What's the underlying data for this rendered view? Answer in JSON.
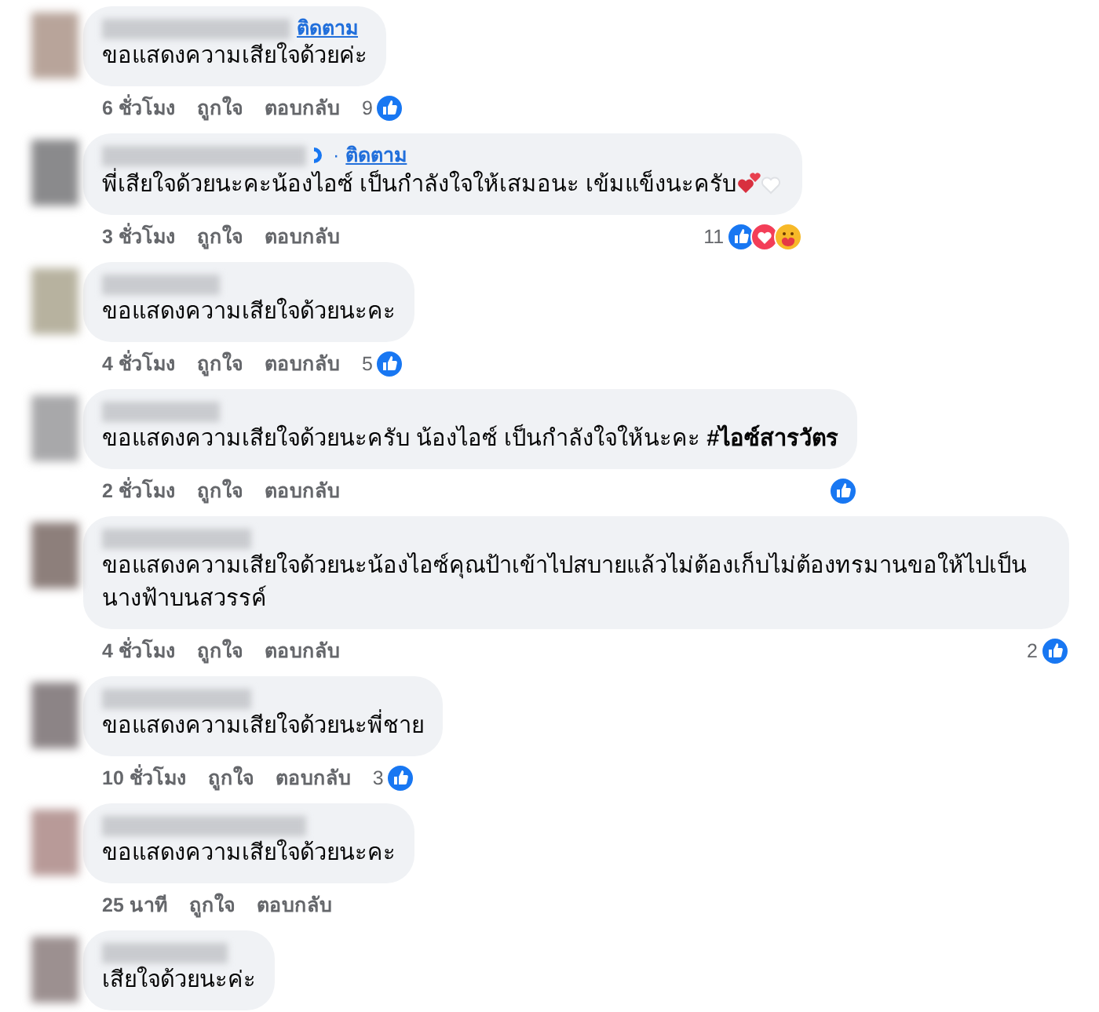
{
  "comments": [
    {
      "follow": "ติดตาม",
      "text": "ขอแสดงความเสียใจด้วยค่ะ",
      "time": "6 ชั่วโมง",
      "like": "ถูกใจ",
      "reply": "ตอบกลับ",
      "reaction_count": "9",
      "reactions": [
        {
          "kind": "like"
        }
      ]
    },
    {
      "follow": "ติดตาม",
      "separator": "·",
      "badge": true,
      "text": "พี่เสียใจด้วยนะคะน้องไอซ์ เป็นกำลังใจให้เสมอนะ เข้มแข็งนะครับ",
      "emoji": true,
      "time": "3 ชั่วโมง",
      "like": "ถูกใจ",
      "reply": "ตอบกลับ",
      "reaction_count": "11",
      "reactions": [
        {
          "kind": "like"
        },
        {
          "kind": "love"
        },
        {
          "kind": "care"
        }
      ],
      "reactions_at_end": true
    },
    {
      "text": "ขอแสดงความเสียใจด้วยนะคะ",
      "time": "4 ชั่วโมง",
      "like": "ถูกใจ",
      "reply": "ตอบกลับ",
      "reaction_count": "5",
      "reactions": [
        {
          "kind": "like"
        }
      ]
    },
    {
      "text": "ขอแสดงความเสียใจด้วยนะครับ น้องไอซ์ เป็นกำลังใจให้นะคะ **#ไอซ์สารวัตร**",
      "time": "2 ชั่วโมง",
      "like": "ถูกใจ",
      "reply": "ตอบกลับ",
      "reactions": [
        {
          "kind": "like"
        }
      ],
      "reactions_at_end": true
    },
    {
      "text": "ขอแสดงความเสียใจด้วยนะน้องไอซ์คุณป้าเข้าไปสบายแล้วไม่ต้องเก็บไม่ต้องทรมานขอให้ไปเป็นนางฟ้าบนสวรรค์",
      "time": "4 ชั่วโมง",
      "like": "ถูกใจ",
      "reply": "ตอบกลับ",
      "reaction_count": "2",
      "reactions": [
        {
          "kind": "like"
        }
      ],
      "reactions_at_end": true
    },
    {
      "text": "ขอแสดงความเสียใจด้วยนะพี่ชาย",
      "time": "10 ชั่วโมง",
      "like": "ถูกใจ",
      "reply": "ตอบกลับ",
      "reaction_count": "3",
      "reactions": [
        {
          "kind": "like"
        }
      ]
    },
    {
      "text": "ขอแสดงความเสียใจด้วยนะคะ",
      "time": "25 นาที",
      "like": "ถูกใจ",
      "reply": "ตอบกลับ"
    },
    {
      "text": "เสียใจด้วยนะค่ะ"
    }
  ]
}
